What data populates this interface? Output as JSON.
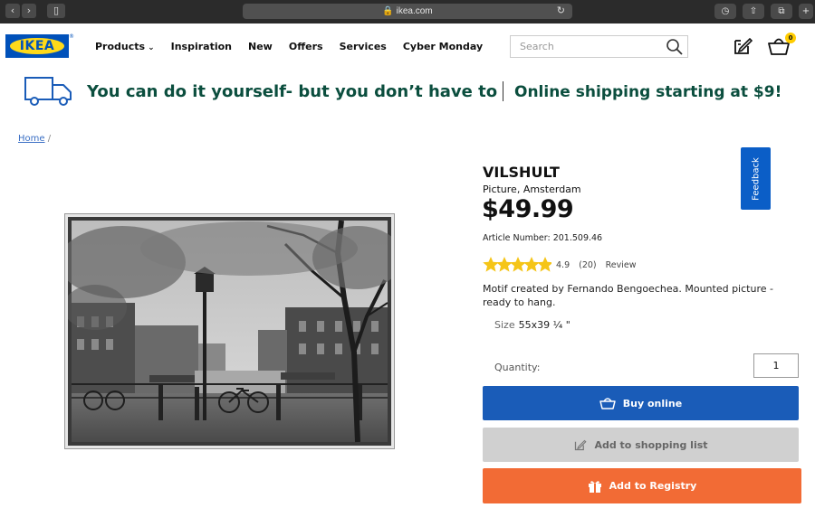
{
  "browser": {
    "url": "ikea.com",
    "lock_icon": "lock-icon"
  },
  "header": {
    "logo_text": "IKEA",
    "logo_reg": "®",
    "nav": [
      {
        "label": "Products"
      },
      {
        "label": "Inspiration"
      },
      {
        "label": "New"
      },
      {
        "label": "Offers"
      },
      {
        "label": "Services"
      },
      {
        "label": "Cyber Monday"
      }
    ],
    "search_placeholder": "Search",
    "cart_count": "0",
    "colors": {
      "brand_blue": "#0051ba",
      "brand_yellow": "#ffda1a"
    }
  },
  "promo": {
    "left_text": "You can do it yourself- but you don’t have to",
    "right_text": "Online shipping starting at $9!",
    "color": "#0b4e3e"
  },
  "breadcrumb": {
    "home": "Home",
    "separator": "/"
  },
  "product": {
    "name": "VILSHULT",
    "subtitle": "Picture, Amsterdam",
    "price": "$49.99",
    "article": "Article Number: 201.509.46",
    "rating": "4.9",
    "reviews": "(20)",
    "review_link": "Review",
    "stars_filled": 4.9,
    "stars_total": 5,
    "description": "Motif created by Fernando Bengoechea. Mounted picture - ready to hang.",
    "size_label": "Size",
    "size_value": "55x39 ¼ \"",
    "quantity_label": "Quantity:",
    "quantity_value": "1",
    "buy_label": "Buy online",
    "list_label": "Add to shopping list",
    "registry_label": "Add to Registry",
    "colors": {
      "buy": "#1a5cb8",
      "registry": "#f26b35",
      "star": "#f5c518"
    }
  },
  "feedback_label": "Feedback"
}
